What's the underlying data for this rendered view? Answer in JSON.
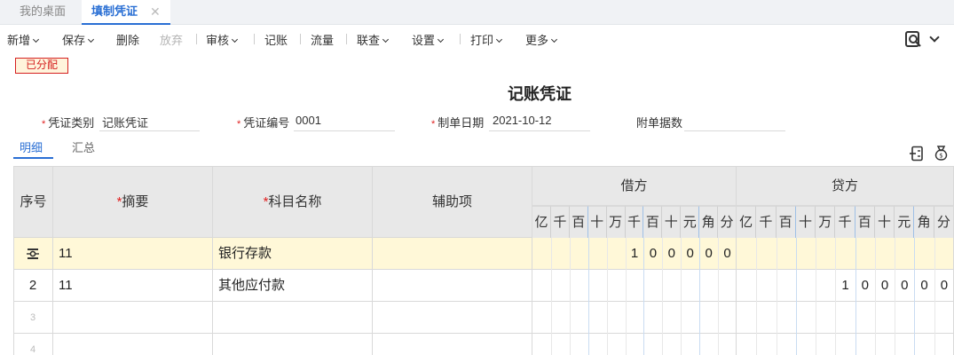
{
  "tabs": [
    {
      "label": "我的桌面"
    },
    {
      "label": "填制凭证",
      "close": "✕"
    }
  ],
  "toolbar": {
    "items": [
      "新增",
      "保存",
      "删除",
      "放弃",
      "审核",
      "记账",
      "流量",
      "联查",
      "设置",
      "打印",
      "更多"
    ],
    "right_icon": "search-document-icon"
  },
  "badge": "已分配",
  "title": "记账凭证",
  "form": {
    "voucher_type_label": "凭证类别",
    "voucher_type_value": "记账凭证",
    "voucher_no_label": "凭证编号",
    "voucher_no_value": "0001",
    "date_label": "制单日期",
    "date_value": "2021-10-12",
    "attachments_label": "附单据数",
    "attachments_value": ""
  },
  "subtabs": [
    "明细",
    "汇总"
  ],
  "grid": {
    "headers": {
      "seq": "序号",
      "summary": "摘要",
      "account": "科目名称",
      "aux": "辅助项",
      "debit": "借方",
      "credit": "贷方"
    },
    "digit_units": [
      "亿",
      "千",
      "百",
      "十",
      "万",
      "千",
      "百",
      "十",
      "元",
      "角",
      "分"
    ],
    "rows": [
      {
        "seq": "",
        "summary": "11",
        "account": "银行存款",
        "aux": "",
        "debit": [
          "",
          "",
          "",
          "",
          "",
          "1",
          "0",
          "0",
          "0",
          "0",
          "0"
        ],
        "credit": [
          "",
          "",
          "",
          "",
          "",
          "",
          "",
          "",
          "",
          "",
          ""
        ]
      },
      {
        "seq": "2",
        "summary": "11",
        "account": "其他应付款",
        "aux": "",
        "debit": [
          "",
          "",
          "",
          "",
          "",
          "",
          "",
          "",
          "",
          "",
          ""
        ],
        "credit": [
          "",
          "",
          "",
          "",
          "",
          "1",
          "0",
          "0",
          "0",
          "0",
          "0"
        ]
      },
      {
        "seq": "3",
        "summary": "",
        "account": "",
        "aux": "",
        "debit": [],
        "credit": []
      },
      {
        "seq": "4",
        "summary": "",
        "account": "",
        "aux": "",
        "debit": [],
        "credit": []
      }
    ]
  }
}
